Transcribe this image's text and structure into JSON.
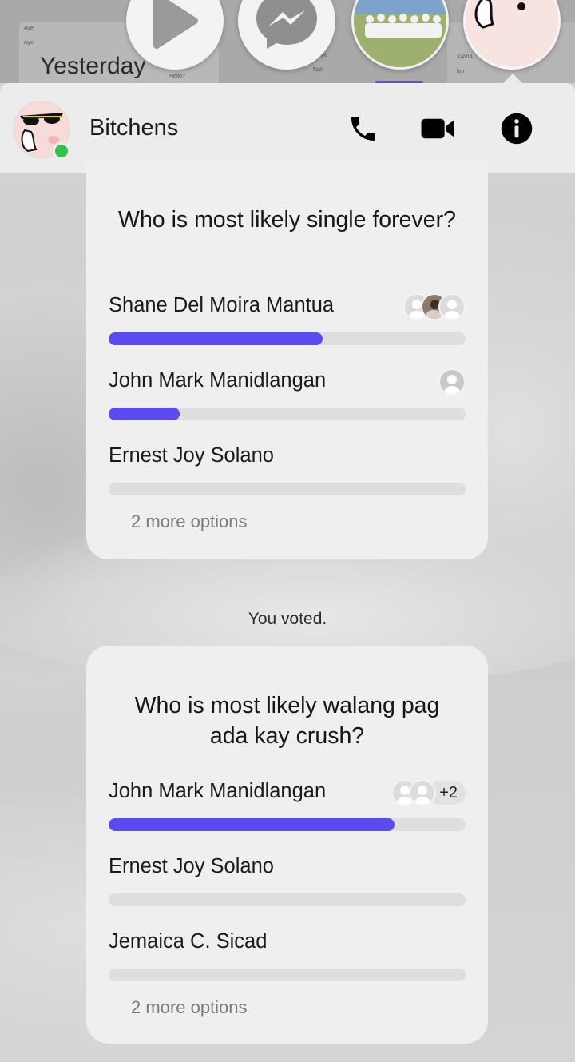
{
  "thread_peek": {
    "day_label": "Yesterday",
    "snippets": [
      "Aye",
      "Aye",
      "Hello?",
      "Aye",
      "Nah",
      "XAVIA",
      "lun"
    ]
  },
  "chat_heads": [
    {
      "icon": "play-icon"
    },
    {
      "icon": "messenger-icon"
    },
    {
      "icon": "group-photo"
    },
    {
      "icon": "sunglasses-avatar"
    }
  ],
  "header": {
    "name": "Bitchens",
    "online": true,
    "status_color": "#31c24d",
    "actions": [
      {
        "icon": "phone-icon"
      },
      {
        "icon": "video-camera-icon"
      },
      {
        "icon": "info-icon"
      }
    ]
  },
  "accent_color": "#5b4af0",
  "polls": [
    {
      "question": "Who is most likely single forever?",
      "options": [
        {
          "label": "Shane Del Moira Mantua",
          "fill_fraction": 0.6,
          "voters": 3,
          "extra": ""
        },
        {
          "label": "John Mark Manidlangan",
          "fill_fraction": 0.2,
          "voters": 1,
          "extra": ""
        },
        {
          "label": "Ernest Joy Solano",
          "fill_fraction": 0,
          "voters": 0,
          "extra": ""
        }
      ],
      "more_options": "2 more options"
    },
    {
      "question": "Who is most likely walang pag ada kay crush?",
      "options": [
        {
          "label": "John Mark Manidlangan",
          "fill_fraction": 0.8,
          "voters": 2,
          "extra": "+2"
        },
        {
          "label": "Ernest Joy Solano",
          "fill_fraction": 0,
          "voters": 0,
          "extra": ""
        },
        {
          "label": "Jemaica C. Sicad",
          "fill_fraction": 0,
          "voters": 0,
          "extra": ""
        }
      ],
      "more_options": "2 more options"
    }
  ],
  "system_message": "You voted."
}
